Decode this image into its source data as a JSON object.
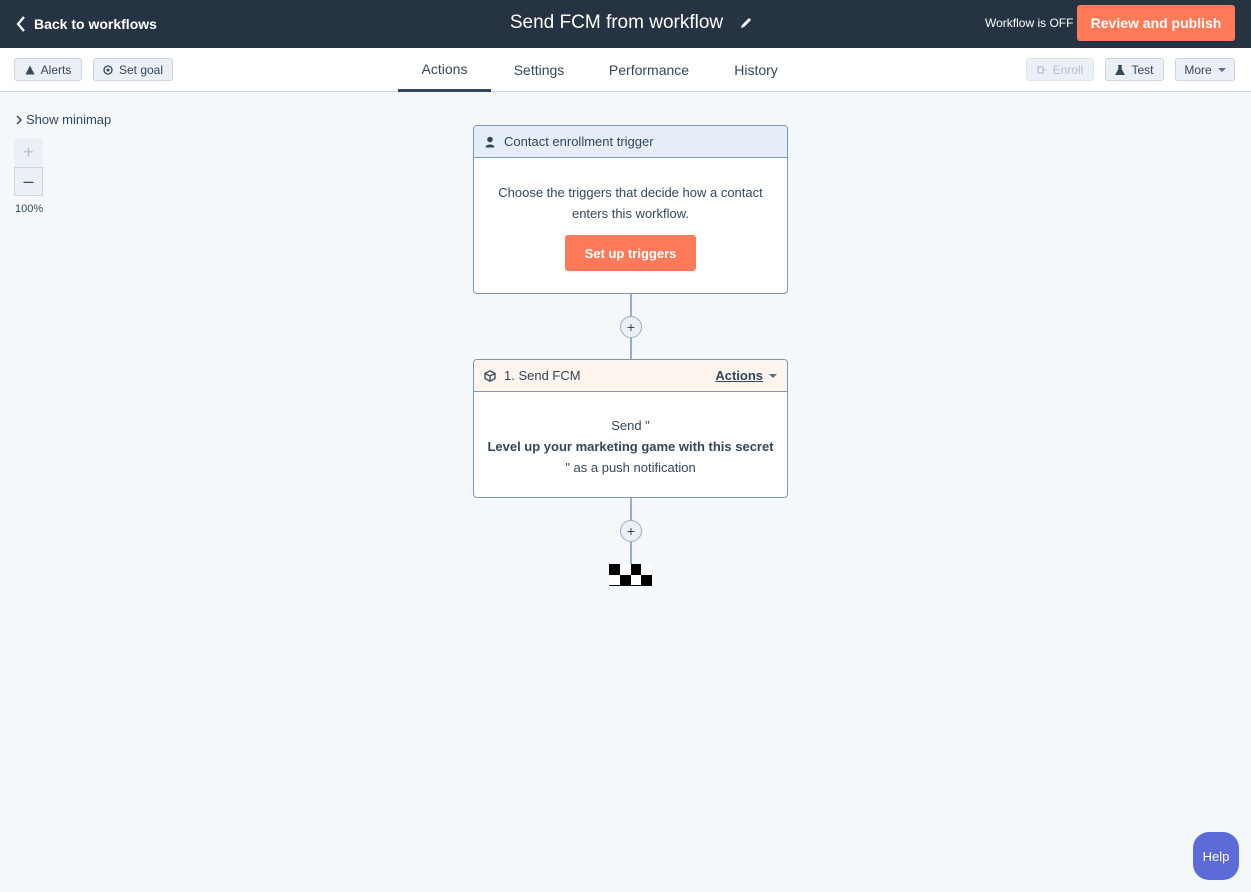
{
  "topbar": {
    "back_label": "Back to workflows",
    "workflow_title": "Send FCM from workflow",
    "status_text": "Workflow is OFF",
    "publish_label": "Review and publish"
  },
  "subbar": {
    "alerts_label": "Alerts",
    "set_goal_label": "Set goal",
    "tabs": [
      "Actions",
      "Settings",
      "Performance",
      "History"
    ],
    "active_tab": "Actions",
    "enroll_label": "Enroll",
    "test_label": "Test",
    "more_label": "More"
  },
  "canvas": {
    "minimap_label": "Show minimap",
    "zoom_in": "+",
    "zoom_out": "–",
    "zoom_level": "100%"
  },
  "trigger": {
    "header": "Contact enrollment trigger",
    "description_line1": "Choose the triggers that decide how a contact",
    "description_line2": "enters this workflow.",
    "button_label": "Set up triggers"
  },
  "action1": {
    "header": "1. Send FCM",
    "actions_label": "Actions",
    "line1": "Send \"",
    "line2": "Level up your marketing game with this secret",
    "line3": "\" as a push notification"
  },
  "help_label": "Help",
  "colors": {
    "topbar": "#253342",
    "accent": "#ff7a59",
    "help": "#5c6bd8"
  }
}
